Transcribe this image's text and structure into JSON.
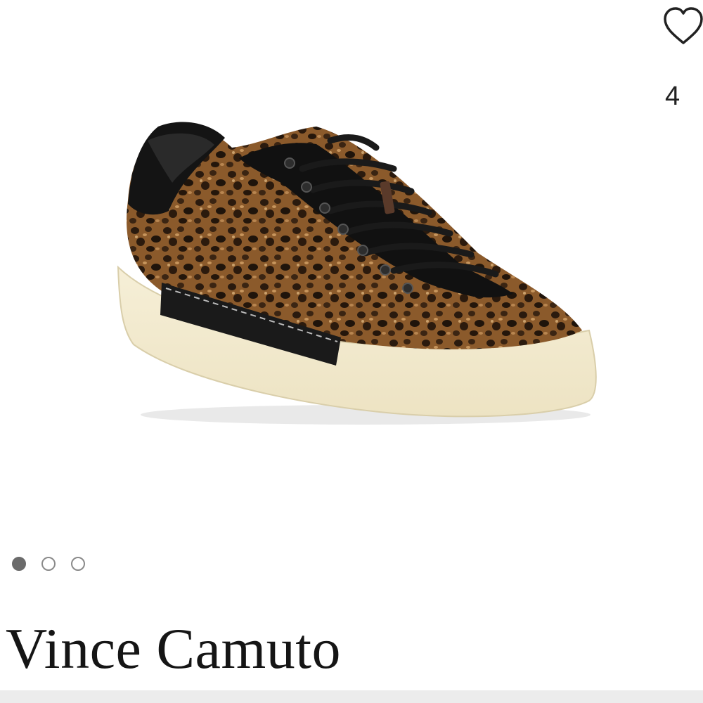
{
  "favorite": {
    "icon": "heart-outline-icon",
    "count": "4"
  },
  "gallery": {
    "image_subject": "shoe-photo",
    "dots": [
      {
        "active": true
      },
      {
        "active": false
      },
      {
        "active": false
      }
    ],
    "dot_active_color": "#6b6b6b",
    "dot_inactive_color": "#8a8a8a"
  },
  "product": {
    "brand": "Vince Camuto"
  }
}
